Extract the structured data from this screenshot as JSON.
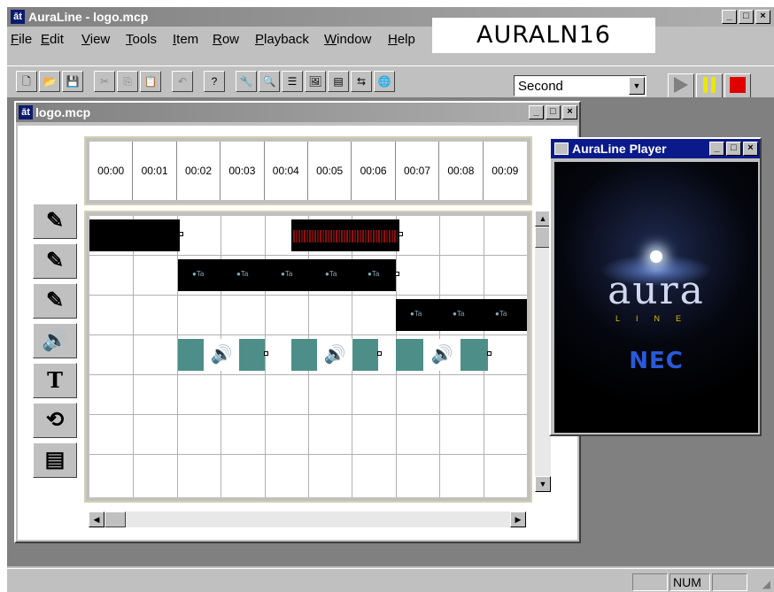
{
  "app": {
    "title": "AuraLine - logo.mcp",
    "icon": "al-app-icon",
    "brand_label": "AURALN16"
  },
  "menu": [
    "File",
    "Edit",
    "View",
    "Tools",
    "Item",
    "Row",
    "Playback",
    "Window",
    "Help"
  ],
  "toolbar": {
    "speed_select": "Second"
  },
  "document": {
    "title": "logo.mcp"
  },
  "timeline": {
    "times": [
      "00:00",
      "00:01",
      "00:02",
      "00:03",
      "00:04",
      "00:05",
      "00:06",
      "00:07",
      "00:08",
      "00:09"
    ]
  },
  "row_icons": [
    "graphics-row-icon",
    "graphics-row-icon",
    "graphics-row-icon",
    "audio-row-icon",
    "text-row-icon",
    "transition-row-icon",
    "notes-row-icon"
  ],
  "player": {
    "title": "AuraLine Player",
    "logo_text": "aura",
    "logo_sub": "LINE",
    "brand": "NEC"
  },
  "status": {
    "num": "NUM"
  },
  "colors": {
    "title_active": "#0a1a8a",
    "title_inactive": "#808080",
    "audio_clip": "#4d8f88",
    "play": "#808080",
    "pause": "#e8e800",
    "stop": "#e00000"
  }
}
